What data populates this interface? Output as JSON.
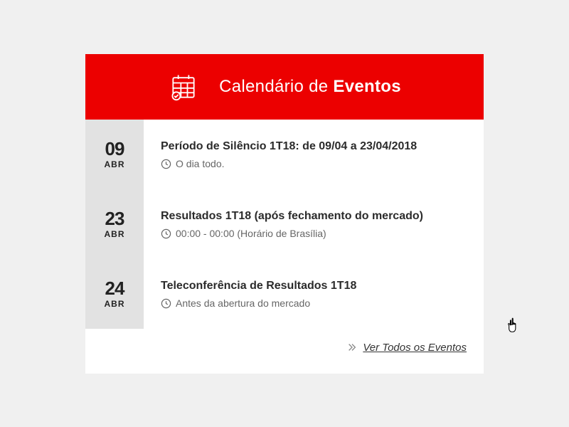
{
  "header": {
    "title_light": "Calendário de ",
    "title_bold": "Eventos"
  },
  "events": [
    {
      "day": "09",
      "month": "ABR",
      "title": "Período de Silêncio 1T18: de 09/04 a 23/04/2018",
      "time": "O dia todo."
    },
    {
      "day": "23",
      "month": "ABR",
      "title": "Resultados 1T18 (após fechamento do mercado)",
      "time": "00:00 - 00:00 (Horário de Brasília)"
    },
    {
      "day": "24",
      "month": "ABR",
      "title": "Teleconferência de Resultados 1T18",
      "time": "Antes da abertura do mercado"
    }
  ],
  "footer": {
    "link_label": "Ver Todos os Eventos"
  }
}
